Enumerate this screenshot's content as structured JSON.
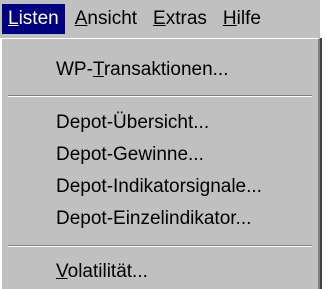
{
  "menubar": {
    "items": [
      {
        "pre": "",
        "ul": "L",
        "post": "isten",
        "active": true
      },
      {
        "pre": "",
        "ul": "A",
        "post": "nsicht",
        "active": false
      },
      {
        "pre": "",
        "ul": "E",
        "post": "xtras",
        "active": false
      },
      {
        "pre": "",
        "ul": "H",
        "post": "ilfe",
        "active": false
      }
    ]
  },
  "dropdown": {
    "items": [
      {
        "pre": "WP-",
        "ul": "T",
        "post": "ransaktionen..."
      },
      {
        "label": "Depot-Übersicht..."
      },
      {
        "label": "Depot-Gewinne..."
      },
      {
        "label": "Depot-Indikatorsignale..."
      },
      {
        "label": "Depot-Einzelindikator..."
      },
      {
        "pre": "",
        "ul": "V",
        "post": "olatilität..."
      }
    ]
  },
  "colors": {
    "menu_background": "#c0c0c0",
    "highlight": "#000080",
    "highlight_text": "#ffffff"
  }
}
